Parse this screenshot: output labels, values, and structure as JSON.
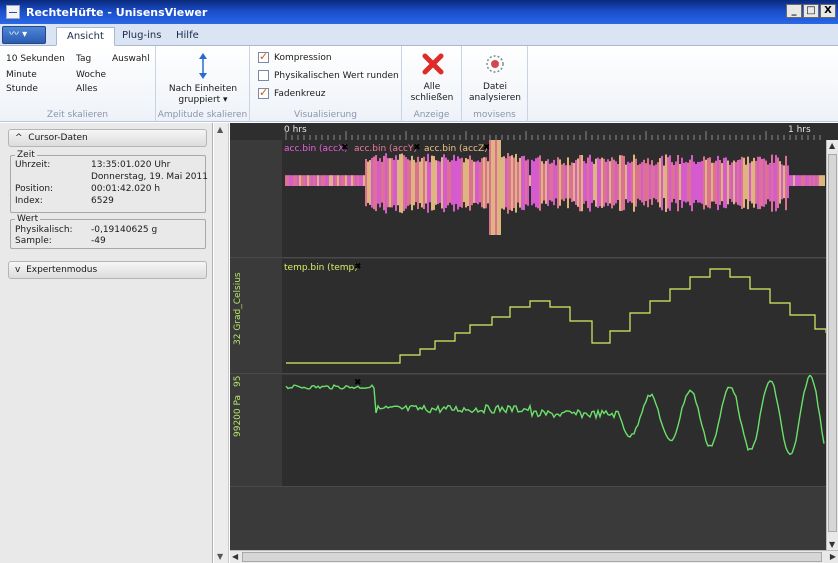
{
  "window": {
    "title": "RechteHüfte - UnisensViewer",
    "buttons": [
      "_",
      "□",
      "X"
    ]
  },
  "tabs": [
    "Ansicht",
    "Plug-ins",
    "Hilfe"
  ],
  "ribbon": {
    "zeit": {
      "items": [
        "10 Sekunden",
        "Tag",
        "Auswahl",
        "Minute",
        "Woche",
        "Stunde",
        "Alles"
      ],
      "label": "Zeit skalieren"
    },
    "amplitude": {
      "button": [
        "Nach Einheiten",
        "gruppiert ▾"
      ],
      "label": "Amplitude skalieren"
    },
    "visualisierung": {
      "options": [
        {
          "label": "Kompression",
          "checked": true
        },
        {
          "label": "Physikalischen Wert runden",
          "checked": false
        },
        {
          "label": "Fadenkreuz",
          "checked": true
        }
      ],
      "label": "Visualisierung"
    },
    "anzeige": {
      "button": [
        "Alle",
        "schließen"
      ],
      "label": "Anzeige"
    },
    "movisens": {
      "button": [
        "Datei",
        "analysieren"
      ],
      "label": "movisens"
    }
  },
  "cursor": {
    "header": "Cursor-Daten",
    "zeit_legend": "Zeit",
    "uhrzeit_label": "Uhrzeit:",
    "uhrzeit_value": "13:35:01.020 Uhr",
    "datum_value": "Donnerstag, 19. Mai 2011",
    "position_label": "Position:",
    "position_value": "00:01:42.020 h",
    "index_label": "Index:",
    "index_value": "6529",
    "wert_legend": "Wert",
    "physikalisch_label": "Physikalisch:",
    "physikalisch_value": "-0,19140625 g",
    "sample_label": "Sample:",
    "sample_value": "-49"
  },
  "experten": {
    "header": "Expertenmodus"
  },
  "ruler": {
    "labels": [
      "0 hrs",
      "1 hrs"
    ]
  },
  "channels": {
    "acc": {
      "titles": [
        "acc.bin (accX)",
        "acc.bin (accY)",
        "acc.bin (accZ)"
      ],
      "colors": [
        "#e860e0",
        "#f07a9c",
        "#f2c488"
      ]
    },
    "temp": {
      "title": "temp.bin (temp)",
      "axis": "32 Grad_Celsius",
      "color": "#d8f064"
    },
    "press": {
      "axis": "99200 Pa",
      "axis_top": "95",
      "color": "#6be06b"
    }
  }
}
